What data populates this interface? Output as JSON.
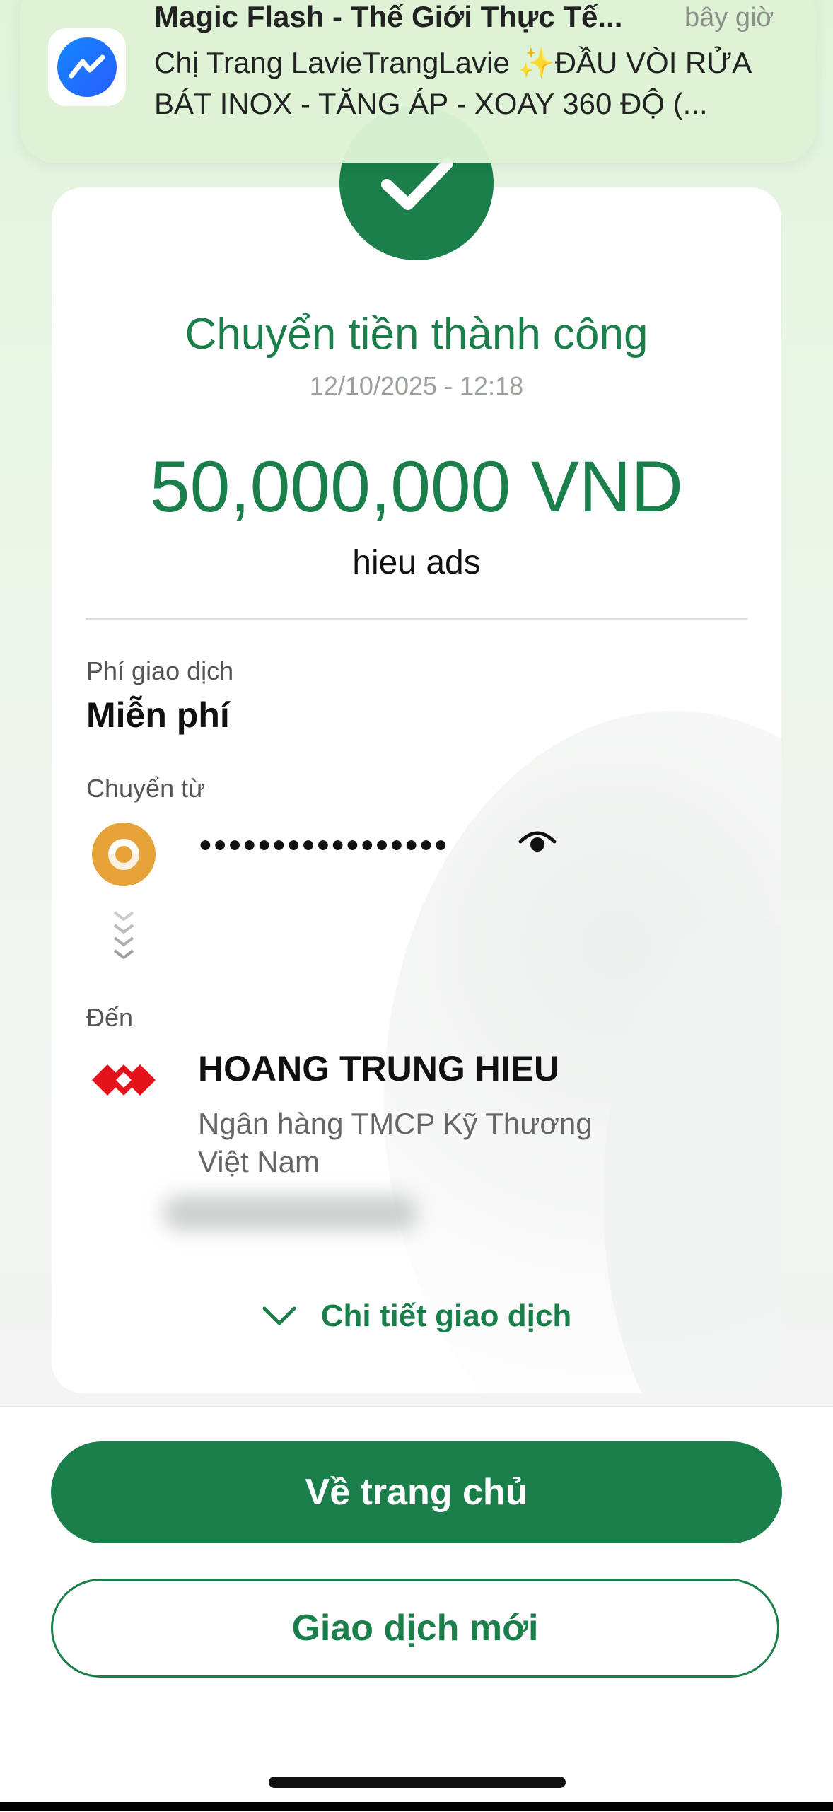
{
  "notification": {
    "title": "Magic Flash - Thế Giới Thực Tế...",
    "time": "bây giờ",
    "body": "Chị Trang LavieTrangLavie ✨ĐẦU VÒI RỬA BÁT INOX - TĂNG ÁP - XOAY 360 ĐỘ (...",
    "app_icon": "messenger-icon"
  },
  "receipt": {
    "status_title": "Chuyển tiền thành công",
    "datetime": "12/10/2025 - 12:18",
    "amount": "50,000,000 VND",
    "memo": "hieu ads",
    "fee_label": "Phí giao dịch",
    "fee_value": "Miễn phí",
    "from_label": "Chuyển từ",
    "from_account_masked": "•••••••••••••••••",
    "to_label": "Đến",
    "recipient_name": "HOANG TRUNG HIEU",
    "recipient_bank": "Ngân hàng TMCP Kỹ Thương Việt Nam",
    "details_link": "Chi tiết giao dịch"
  },
  "actions": {
    "home_button": "Về trang chủ",
    "new_transaction_button": "Giao dịch mới"
  },
  "colors": {
    "accent": "#1a7f4b",
    "from_bank_logo": "#e6a33a",
    "to_bank_logo": "#e3121b"
  }
}
